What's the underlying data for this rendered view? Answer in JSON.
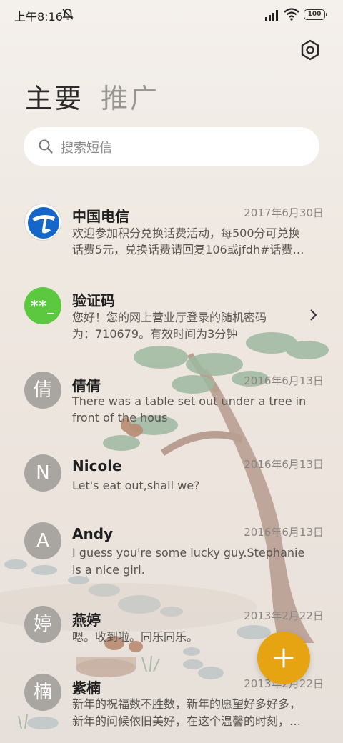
{
  "status_bar": {
    "time": "上午8:16",
    "battery": "100"
  },
  "tabs": [
    {
      "label": "主要"
    },
    {
      "label": "推广"
    }
  ],
  "search": {
    "placeholder": "搜索短信"
  },
  "conversations": [
    {
      "name": "中国电信",
      "date": "2017年6月30日",
      "line1": "欢迎参加积分兑换话费活动，每500分可兑换",
      "line2": "话费5元，兑换话费请回复106或jfdh#话费…",
      "avatar_type": "telecom-logo"
    },
    {
      "name": "验证码",
      "date": "",
      "line1": "您好！您的网上营业厅登录的随机密码",
      "line2": "为：710679。有效时间为3分钟",
      "avatar_text": "**_"
    },
    {
      "name": "倩倩",
      "date": "2016年6月13日",
      "line1": "There was a table set out under a tree in",
      "line2": "front of the hous",
      "avatar_text": "倩"
    },
    {
      "name": "Nicole",
      "date": "2016年6月13日",
      "line1": "Let's eat out,shall we?",
      "line2": "",
      "avatar_text": "N"
    },
    {
      "name": "Andy",
      "date": "2016年6月13日",
      "line1": "I guess you're some lucky guy.Stephanie",
      "line2": "is a nice girl.",
      "avatar_text": "A"
    },
    {
      "name": "燕婷",
      "date": "2013年2月22日",
      "line1": "嗯。收到啦。同乐同乐。",
      "line2": "",
      "avatar_text": "婷"
    },
    {
      "name": "紫楠",
      "date": "2013年2月22日",
      "line1": "新年的祝福数不胜数，新年的愿望好多好多，",
      "line2": "新年的问候依旧美好，在这个温馨的时刻，…",
      "avatar_text": "楠"
    }
  ],
  "colors": {
    "accent": "#e6a413",
    "verify_green": "#5bc840",
    "avatar_gray": "#a9a5a0"
  },
  "icons": {
    "settings": "settings-hexagon-icon",
    "fab": "plus-icon",
    "search": "search-icon"
  }
}
